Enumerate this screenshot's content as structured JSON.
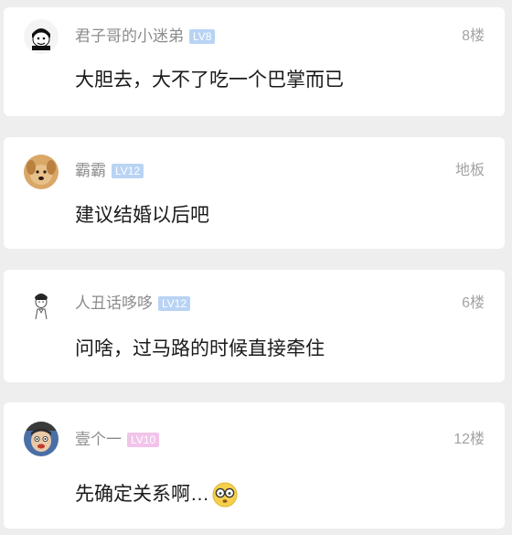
{
  "comments": [
    {
      "avatar": "cartoon-avatar-icon",
      "username": "君子哥的小迷弟",
      "level": "LV8",
      "level_color": "#b9d3f4",
      "floor": "8楼",
      "text": "大胆去，大不了吃一个巴掌而已"
    },
    {
      "avatar": "dog-avatar-icon",
      "username": "霸霸",
      "level": "LV12",
      "level_color": "#b9d3f4",
      "floor": "地板",
      "text": "建议结婚以后吧"
    },
    {
      "avatar": "sketch-person-avatar-icon",
      "username": "人丑话哆哆",
      "level": "LV12",
      "level_color": "#b9d3f4",
      "floor": "6楼",
      "text": "问啥，过马路的时候直接牵住"
    },
    {
      "avatar": "face-photo-avatar-icon",
      "username": "壹个一",
      "level": "LV10",
      "level_color": "#f2c4ea",
      "floor": "12楼",
      "text": "先确定关系啊…",
      "trailing_emoji": "glasses-face-emoji-icon"
    }
  ]
}
